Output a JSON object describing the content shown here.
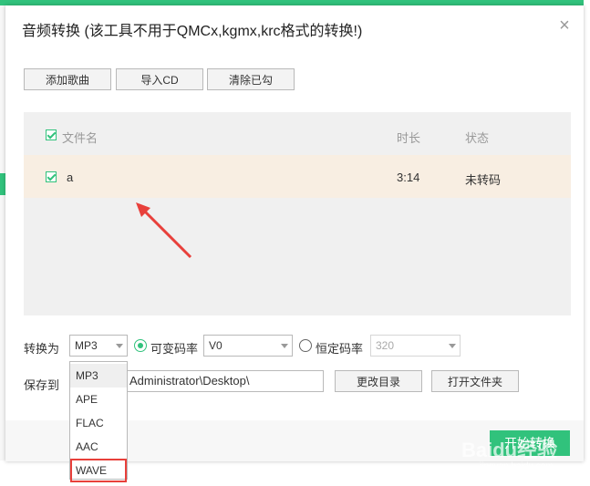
{
  "dialog": {
    "title": "音频转换 (该工具不用于QMCx,kgmx,krc格式的转换!)",
    "close": "×"
  },
  "toolbar": {
    "add_song": "添加歌曲",
    "import_cd": "导入CD",
    "clear_checked": "清除已勾"
  },
  "list": {
    "headers": {
      "filename": "文件名",
      "duration": "时长",
      "status": "状态"
    },
    "rows": [
      {
        "filename": "a",
        "duration": "3:14",
        "status": "未转码",
        "checked": true
      }
    ]
  },
  "convert": {
    "label": "转换为",
    "format": "MP3",
    "vbr_label": "可变码率",
    "vbr_value": "V0",
    "cbr_label": "恒定码率",
    "cbr_value": "320",
    "options": [
      "MP3",
      "APE",
      "FLAC",
      "AAC",
      "WAVE"
    ]
  },
  "save": {
    "label": "保存到",
    "path": "Administrator\\Desktop\\",
    "change_dir": "更改目录",
    "open_folder": "打开文件夹"
  },
  "footer": {
    "start": "开始转换"
  },
  "watermark": {
    "text": "Baidu经验",
    "sub": "jingyan.baidu.com"
  },
  "colors": {
    "accent": "#31c27c",
    "row_highlight": "#f8eee2",
    "annotation": "#e8403b"
  }
}
